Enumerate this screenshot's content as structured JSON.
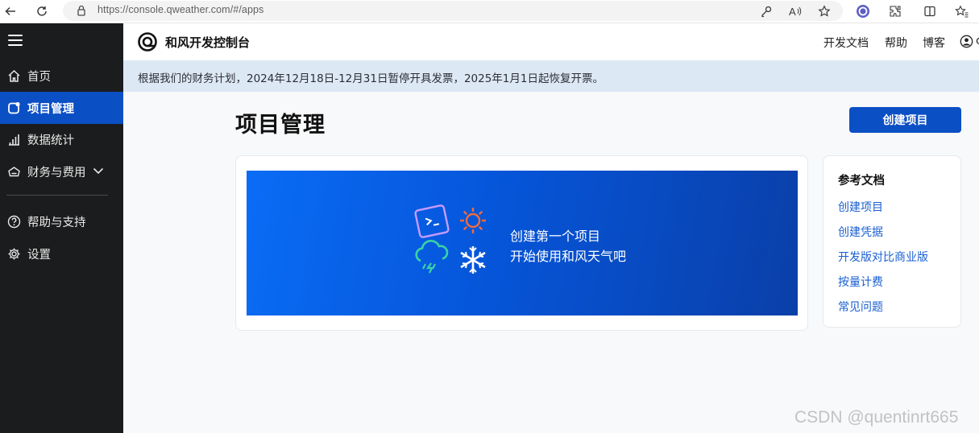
{
  "browser": {
    "url": "https://console.qweather.com/#/apps",
    "icons": [
      "back-icon",
      "reload-icon",
      "lock-icon",
      "key-icon",
      "read-aloud-icon",
      "favorite-icon",
      "extension-badge-icon",
      "extensions-icon",
      "split-screen-icon",
      "favorites-icon"
    ]
  },
  "sidebar": {
    "items": [
      {
        "label": "首页",
        "icon": "home-icon"
      },
      {
        "label": "项目管理",
        "icon": "project-icon",
        "active": true
      },
      {
        "label": "数据统计",
        "icon": "bar-chart-icon"
      },
      {
        "label": "财务与费用",
        "icon": "wallet-icon",
        "expandable": true
      },
      {
        "label": "帮助与支持",
        "icon": "help-icon"
      },
      {
        "label": "设置",
        "icon": "gear-icon"
      }
    ]
  },
  "header": {
    "brand": "和风开发控制台",
    "links": [
      "开发文档",
      "帮助",
      "博客"
    ],
    "user_initial": "c"
  },
  "notice": {
    "text": "根据我们的财务计划，2024年12月18日-12月31日暂停开具发票，2025年1月1日起恢复开票。"
  },
  "main": {
    "title": "项目管理",
    "create_button": "创建项目",
    "banner": {
      "line1": "创建第一个项目",
      "line2": "开始使用和风天气吧"
    }
  },
  "docs": {
    "title": "参考文档",
    "links": [
      "创建项目",
      "创建凭据",
      "开发版对比商业版",
      "按量计费",
      "常见问题"
    ]
  },
  "watermark": "CSDN @quentinrt665",
  "colors": {
    "sidebar_bg": "#1b1c1d",
    "accent": "#0b4fc4",
    "notice_bg": "#dde8f5",
    "link": "#1a5fd1"
  }
}
